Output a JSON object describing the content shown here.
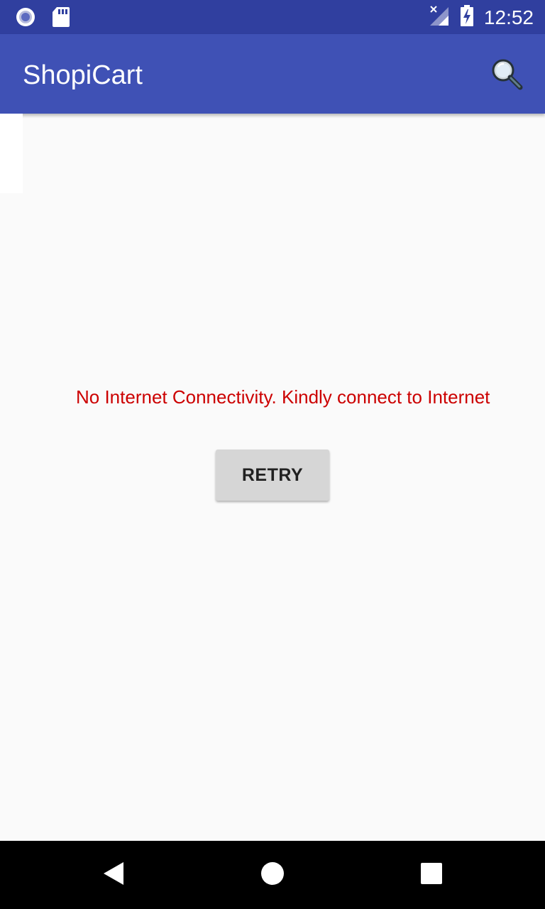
{
  "status_bar": {
    "time": "12:52",
    "icons": [
      "record-icon",
      "sd-card-icon",
      "no-signal-icon",
      "battery-charging-icon"
    ]
  },
  "app_bar": {
    "title": "ShopiCart",
    "search_icon": "search-icon"
  },
  "main": {
    "error_message": "No Internet Connectivity. Kindly connect to Internet",
    "retry_label": "RETRY"
  },
  "nav_bar": {
    "icons": [
      "back-icon",
      "home-icon",
      "recents-icon"
    ]
  },
  "colors": {
    "status_bar": "#303f9f",
    "app_bar": "#3f51b5",
    "error_text": "#cc0000",
    "button_bg": "#d6d6d6",
    "background": "#fafafa"
  }
}
